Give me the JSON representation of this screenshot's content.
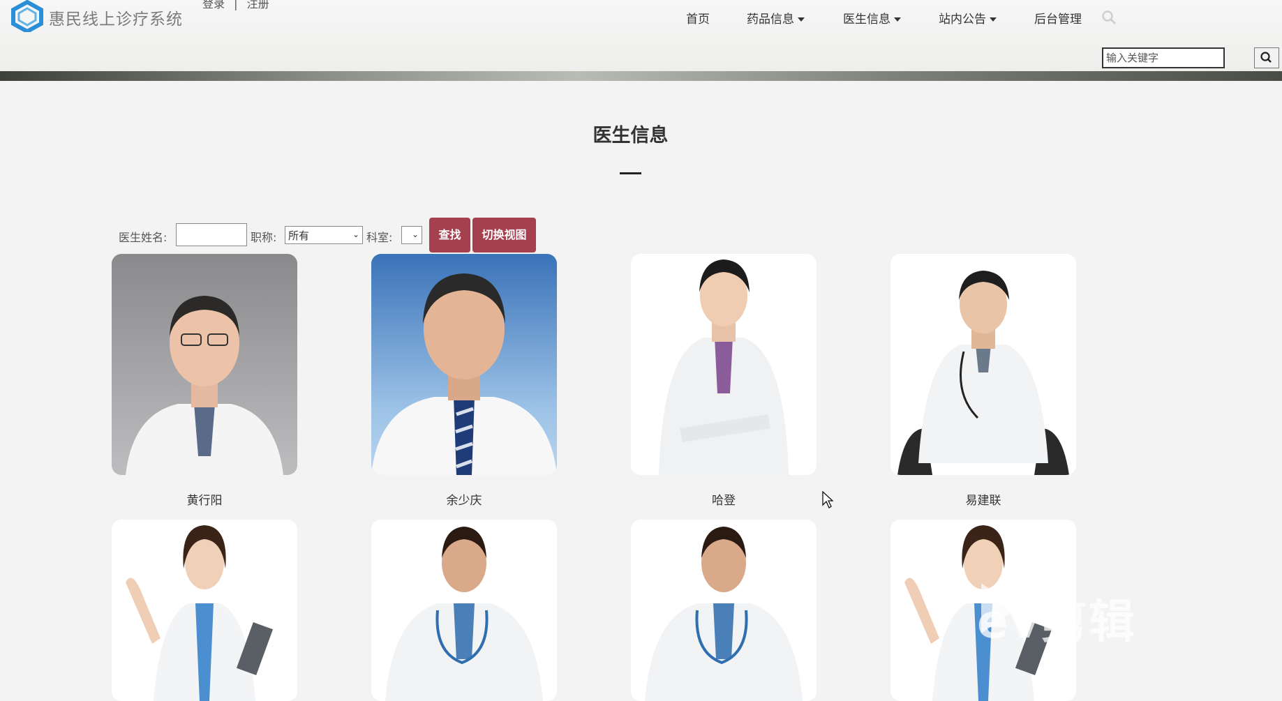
{
  "header": {
    "site_title": "惠民线上诊疗系统",
    "login_label": "登录",
    "separator": "|",
    "register_label": "注册",
    "nav": [
      {
        "label": "首页",
        "dropdown": false
      },
      {
        "label": "药品信息",
        "dropdown": true
      },
      {
        "label": "医生信息",
        "dropdown": true
      },
      {
        "label": "站内公告",
        "dropdown": true
      },
      {
        "label": "后台管理",
        "dropdown": false
      }
    ],
    "search_placeholder": "输入关键字"
  },
  "main": {
    "title": "医生信息",
    "filters": {
      "name_label": "医生姓名:",
      "name_value": "",
      "title_label": "职称:",
      "title_value": "所有",
      "dept_label": "科室:",
      "dept_value": "",
      "search_button": "查找",
      "switch_view_button": "切换视图"
    },
    "doctors": [
      {
        "name": "黄行阳"
      },
      {
        "name": "余少庆"
      },
      {
        "name": "哈登"
      },
      {
        "name": "易建联"
      },
      {
        "name": ""
      },
      {
        "name": ""
      },
      {
        "name": ""
      },
      {
        "name": ""
      }
    ]
  },
  "watermark": "ev剪辑",
  "colors": {
    "accent_button": "#a5404f",
    "page_background": "#f3f3f3",
    "logo_blue": "#2a8fd6"
  },
  "icons": {
    "logo": "hexagon-logo-icon",
    "nav_search": "search-icon",
    "search_button": "search-icon"
  }
}
